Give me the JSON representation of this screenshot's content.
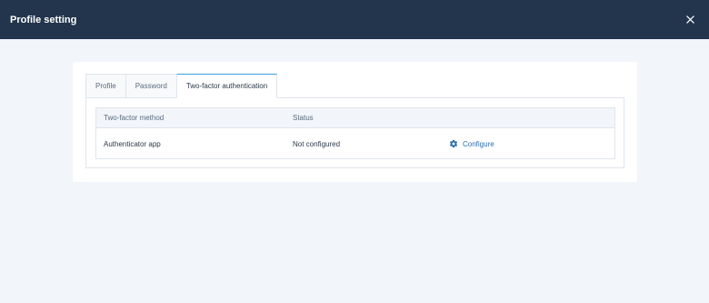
{
  "modal": {
    "title": "Profile setting",
    "close_icon": "close-icon"
  },
  "tabs": [
    {
      "label": "Profile",
      "active": false
    },
    {
      "label": "Password",
      "active": false
    },
    {
      "label": "Two-factor authentication",
      "active": true
    }
  ],
  "table": {
    "headers": [
      "Two-factor method",
      "Status",
      ""
    ],
    "rows": [
      {
        "method": "Authenticator app",
        "status": "Not configured",
        "action_label": "Configure",
        "action_icon": "gear-icon"
      }
    ]
  },
  "colors": {
    "header_bg": "#22354c",
    "accent": "#3aa0e0",
    "link": "#2a6db0",
    "page_bg": "#f2f5f9"
  }
}
